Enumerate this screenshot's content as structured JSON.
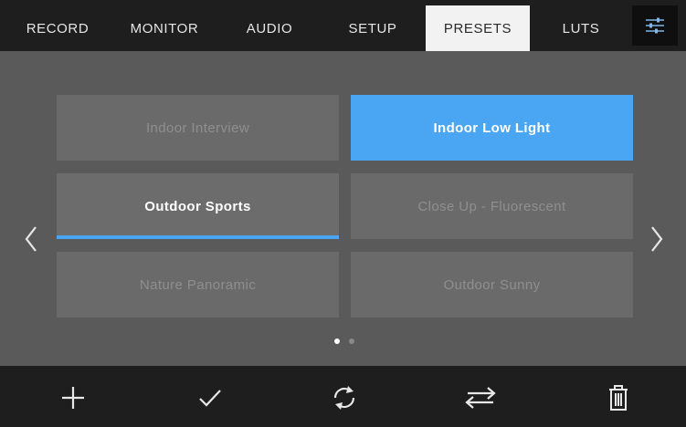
{
  "tabs": [
    {
      "label": "RECORD",
      "active": false
    },
    {
      "label": "MONITOR",
      "active": false
    },
    {
      "label": "AUDIO",
      "active": false
    },
    {
      "label": "SETUP",
      "active": false
    },
    {
      "label": "PRESETS",
      "active": true
    },
    {
      "label": "LUTS",
      "active": false
    }
  ],
  "settings_tab": {
    "icon": "sliders-icon"
  },
  "presets": [
    {
      "name": "Indoor Interview",
      "state": "normal"
    },
    {
      "name": "Indoor Low Light",
      "state": "loaded"
    },
    {
      "name": "Outdoor Sports",
      "state": "selected"
    },
    {
      "name": "Close Up - Fluorescent",
      "state": "normal"
    },
    {
      "name": "Nature Panoramic",
      "state": "normal"
    },
    {
      "name": "Outdoor Sunny",
      "state": "normal"
    }
  ],
  "pager": {
    "current_page": 1,
    "total_pages": 2
  },
  "navigation": {
    "prev_icon": "chevron-left-icon",
    "next_icon": "chevron-right-icon"
  },
  "toolbar": {
    "items": [
      {
        "icon": "add-icon"
      },
      {
        "icon": "checkmark-icon"
      },
      {
        "icon": "refresh-icon"
      },
      {
        "icon": "import-export-icon"
      },
      {
        "icon": "trash-icon"
      }
    ]
  },
  "colors": {
    "accent": "#4aa6f2",
    "bar_background": "#1e1e1e",
    "panel_background": "#5a5a5a",
    "tile_background": "#6a6a6a"
  }
}
